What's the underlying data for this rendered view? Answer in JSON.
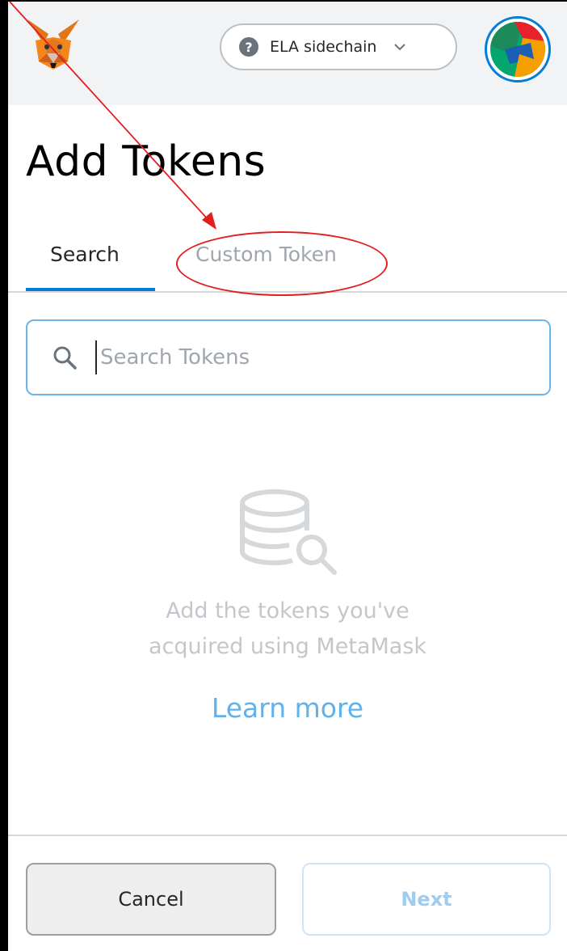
{
  "header": {
    "network": {
      "label": "ELA sidechain",
      "icon": "question-circle-icon",
      "chevron": "chevron-down-icon"
    },
    "logo": "metamask-fox-icon",
    "avatar": "account-identicon"
  },
  "page": {
    "title": "Add Tokens"
  },
  "tabs": [
    {
      "label": "Search",
      "active": true
    },
    {
      "label": "Custom Token",
      "active": false
    }
  ],
  "search": {
    "placeholder": "Search Tokens",
    "value": "",
    "icon": "search-icon"
  },
  "empty_state": {
    "icon": "coin-stack-search-icon",
    "line1": "Add the tokens you've",
    "line2": "acquired using MetaMask",
    "learn_more": "Learn more"
  },
  "footer": {
    "cancel_label": "Cancel",
    "next_label": "Next"
  },
  "annotation": {
    "color": "#e31e1e",
    "target": "tab-custom-token"
  },
  "colors": {
    "accent": "#037dd6",
    "header_bg": "#f2f3f4",
    "muted_text": "#c3c7cb",
    "link": "#5fb2ea"
  }
}
